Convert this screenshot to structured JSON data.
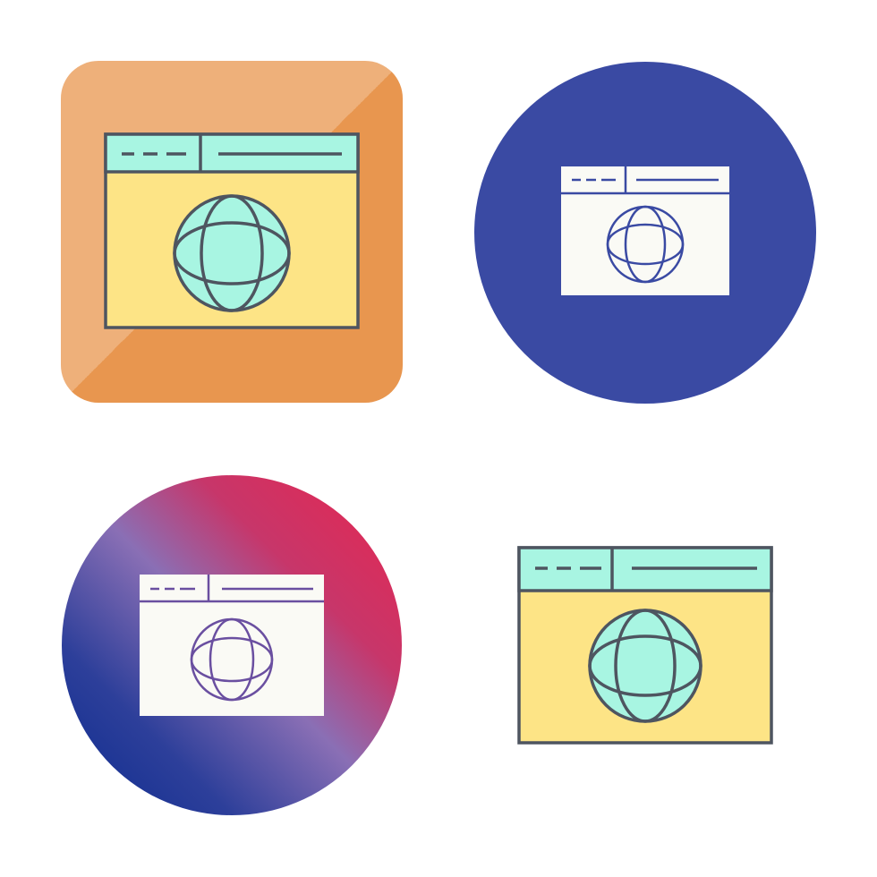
{
  "icon_set": {
    "subject": "web-browser-globe-icon",
    "variants": [
      {
        "id": "filled-rounded-square",
        "icon": "browser-globe-icon"
      },
      {
        "id": "glyph-circle",
        "icon": "browser-globe-icon"
      },
      {
        "id": "gradient-circle",
        "icon": "browser-globe-icon"
      },
      {
        "id": "filled-plain",
        "icon": "browser-globe-icon"
      }
    ]
  },
  "colors": {
    "background": "#ffffff",
    "orange_light": "#eeb07a",
    "orange_dark": "#e8964f",
    "blue_circle": "#3a4aa3",
    "gradient_pink": "#d8315f",
    "gradient_lavender": "#8a6fb5",
    "gradient_navy": "#0b2a8e",
    "header_mint": "#a8f5e2",
    "body_yellow": "#fde486",
    "globe_mint": "#a8f5e2",
    "outline": "#4e5560",
    "glyph_white": "#fafaf5",
    "glyph_line_blue": "#3a4aa3",
    "glyph_line_purple": "#6a4fa0"
  }
}
